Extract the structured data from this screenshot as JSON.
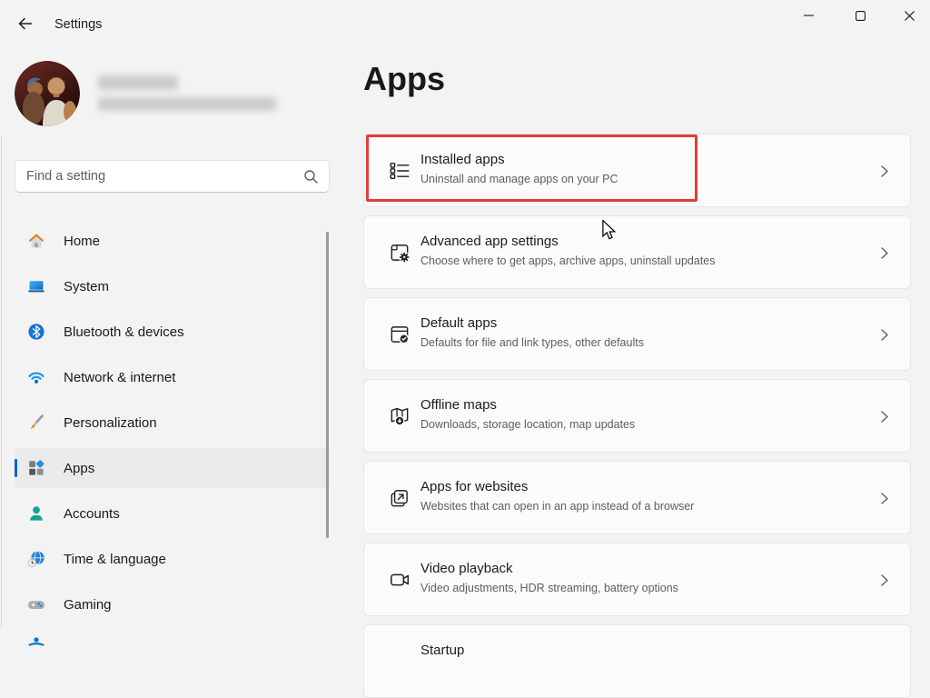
{
  "window": {
    "title": "Settings"
  },
  "titlebar_icons": {
    "back": "back-arrow",
    "minimize": "minimize",
    "maximize": "maximize",
    "close": "close"
  },
  "profile": {
    "name_redacted": true,
    "email_redacted": true
  },
  "sidebar": {
    "search_placeholder": "Find a setting",
    "items": [
      {
        "label": "Home",
        "icon": "home-icon",
        "selected": false
      },
      {
        "label": "System",
        "icon": "system-icon",
        "selected": false
      },
      {
        "label": "Bluetooth & devices",
        "icon": "bluetooth-icon",
        "selected": false
      },
      {
        "label": "Network & internet",
        "icon": "network-icon",
        "selected": false
      },
      {
        "label": "Personalization",
        "icon": "personalization-icon",
        "selected": false
      },
      {
        "label": "Apps",
        "icon": "apps-icon",
        "selected": true
      },
      {
        "label": "Accounts",
        "icon": "accounts-icon",
        "selected": false
      },
      {
        "label": "Time & language",
        "icon": "time-language-icon",
        "selected": false
      },
      {
        "label": "Gaming",
        "icon": "gaming-icon",
        "selected": false
      }
    ],
    "partial_bottom_item_icon": "accessibility-icon"
  },
  "main": {
    "page_title": "Apps",
    "cards": [
      {
        "title": "Installed apps",
        "subtitle": "Uninstall and manage apps on your PC",
        "icon": "installed-apps-icon",
        "annotated": true
      },
      {
        "title": "Advanced app settings",
        "subtitle": "Choose where to get apps, archive apps, uninstall updates",
        "icon": "advanced-app-settings-icon",
        "annotated": false
      },
      {
        "title": "Default apps",
        "subtitle": "Defaults for file and link types, other defaults",
        "icon": "default-apps-icon",
        "annotated": false
      },
      {
        "title": "Offline maps",
        "subtitle": "Downloads, storage location, map updates",
        "icon": "offline-maps-icon",
        "annotated": false
      },
      {
        "title": "Apps for websites",
        "subtitle": "Websites that can open in an app instead of a browser",
        "icon": "apps-for-websites-icon",
        "annotated": false
      },
      {
        "title": "Video playback",
        "subtitle": "Video adjustments, HDR streaming, battery options",
        "icon": "video-playback-icon",
        "annotated": false
      },
      {
        "title": "Startup",
        "subtitle": "",
        "icon": "startup-icon",
        "annotated": false,
        "partially_visible": true
      }
    ]
  },
  "annotation": {
    "type": "red-box",
    "target": "Installed apps",
    "color": "#E23B3B"
  },
  "colors": {
    "accent": "#0067C0",
    "window_bg": "#F3F3F3",
    "card_bg": "#FBFBFB",
    "selected_nav_bg": "#EAEAEA",
    "annotation_red": "#E23B3B"
  }
}
